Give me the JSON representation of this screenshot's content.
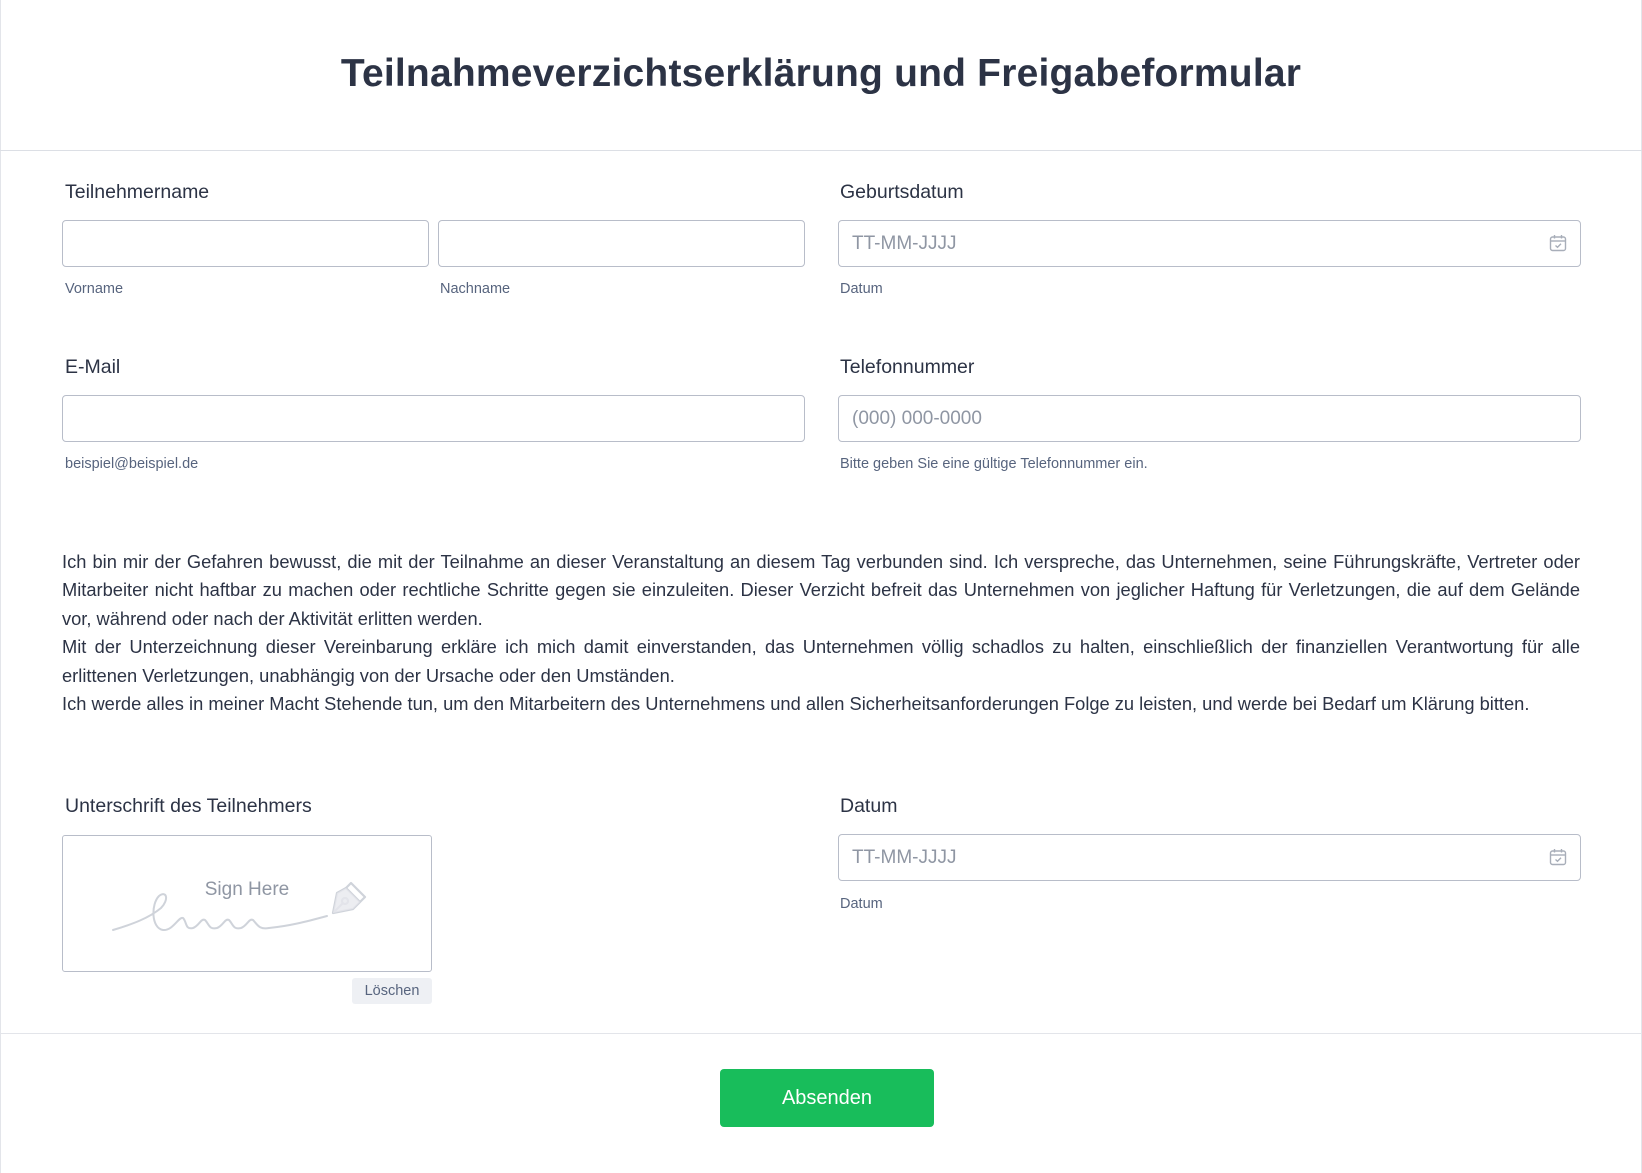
{
  "form": {
    "title": "Teilnahmeverzichtserklärung und Freigabeformular",
    "participant_name": {
      "label": "Teilnehmername",
      "first_sublabel": "Vorname",
      "last_sublabel": "Nachname",
      "first_value": "",
      "last_value": ""
    },
    "birth_date": {
      "label": "Geburtsdatum",
      "placeholder": "TT-MM-JJJJ",
      "sublabel": "Datum",
      "icon": "calendar-icon"
    },
    "email": {
      "label": "E-Mail",
      "value": "",
      "sublabel": "beispiel@beispiel.de"
    },
    "phone": {
      "label": "Telefonnummer",
      "placeholder": "(000) 000-0000",
      "sublabel": "Bitte geben Sie eine gültige Telefonnummer ein."
    },
    "waiver_text": [
      "Ich bin mir der Gefahren bewusst, die mit der Teilnahme an dieser Veranstaltung an diesem Tag verbunden sind. Ich verspreche, das Unternehmen, seine Führungskräfte, Vertreter oder Mitarbeiter nicht haftbar zu machen oder rechtliche Schritte gegen sie einzuleiten. Dieser Verzicht befreit das Unternehmen von jeglicher Haftung für Verletzungen, die auf dem Gelände vor, während oder nach der Aktivität erlitten werden.",
      "Mit der Unterzeichnung dieser Vereinbarung erkläre ich mich damit einverstanden, das Unternehmen völlig schadlos zu halten, einschließlich der finanziellen Verantwortung für alle erlittenen Verletzungen, unabhängig von der Ursache oder den Umständen.",
      "Ich werde alles in meiner Macht Stehende tun, um den Mitarbeitern des Unternehmens und allen Sicherheitsanforderungen Folge zu leisten, und werde bei Bedarf um Klärung bitten."
    ],
    "signature": {
      "label": "Unterschrift des Teilnehmers",
      "placeholder": "Sign Here",
      "clear_label": "Löschen",
      "icon": "pen-nib-icon"
    },
    "date": {
      "label": "Datum",
      "placeholder": "TT-MM-JJJJ",
      "sublabel": "Datum",
      "icon": "calendar-icon"
    },
    "submit_label": "Absenden"
  },
  "colors": {
    "text": "#2c3345",
    "sublabel": "#57647e",
    "placeholder": "#8f96a3",
    "border": "#b8bdc9",
    "submit_bg": "#18bd5b",
    "clear_bg": "#eef0f4"
  }
}
